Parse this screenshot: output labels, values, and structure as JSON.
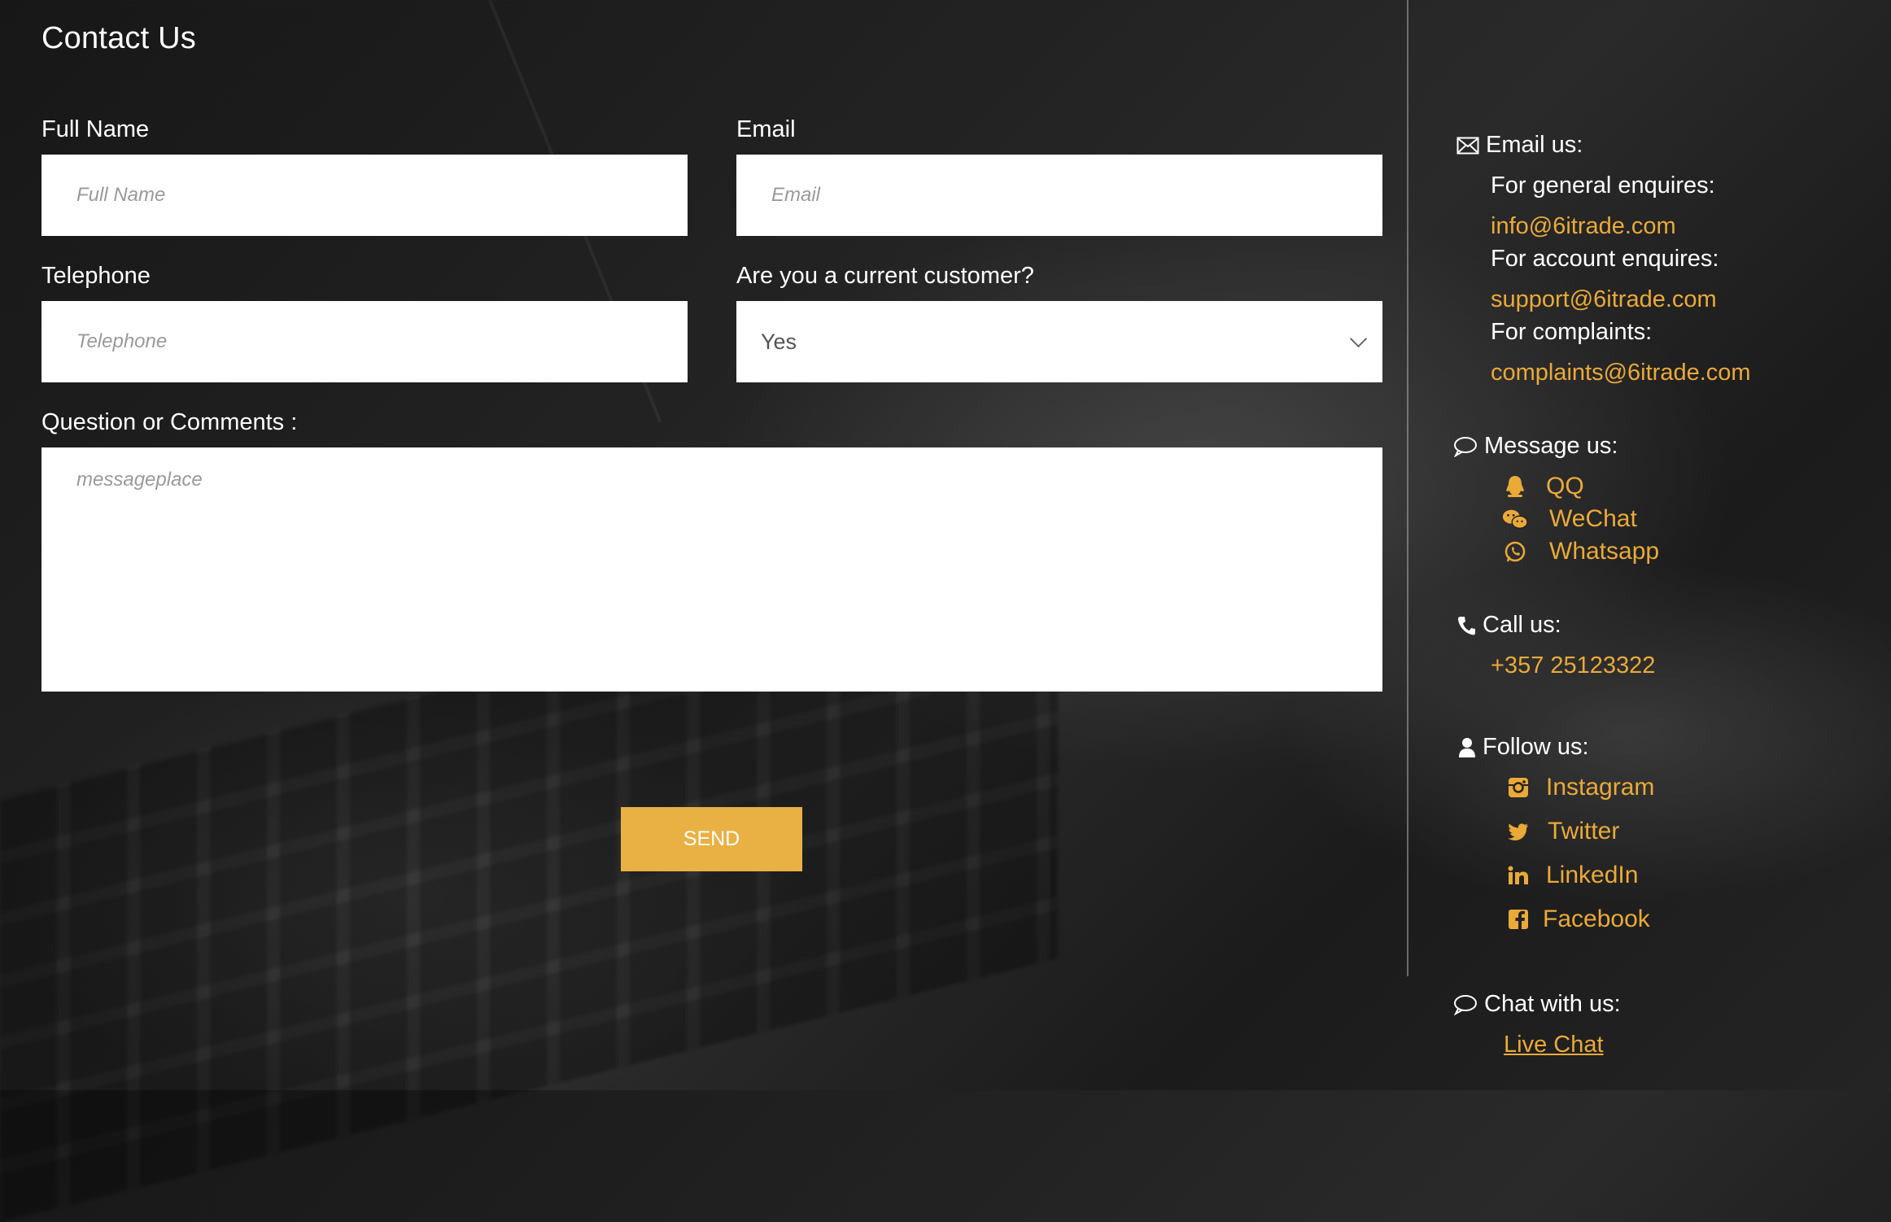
{
  "page_title": "Contact Us",
  "form": {
    "full_name": {
      "label": "Full Name",
      "placeholder": "Full Name",
      "value": ""
    },
    "email": {
      "label": "Email",
      "placeholder": "Email",
      "value": ""
    },
    "telephone": {
      "label": "Telephone",
      "placeholder": "Telephone",
      "value": ""
    },
    "customer": {
      "label": "Are you a current customer?",
      "selected": "Yes"
    },
    "comments": {
      "label": "Question or Comments :",
      "placeholder": "messageplace",
      "value": ""
    },
    "send_label": "SEND"
  },
  "sidebar": {
    "email": {
      "heading": "Email us:",
      "icon": "envelope-icon",
      "general_label": "For general enquires:",
      "general_email": "info@6itrade.com",
      "account_label": "For account enquires:",
      "account_email": "support@6itrade.com",
      "complaints_label": "For complaints:",
      "complaints_email": "complaints@6itrade.com"
    },
    "message": {
      "heading": "Message us:",
      "icon": "speech-bubble-icon",
      "items": [
        {
          "label": "QQ",
          "icon": "qq-icon"
        },
        {
          "label": "WeChat",
          "icon": "wechat-icon"
        },
        {
          "label": "Whatsapp",
          "icon": "whatsapp-icon"
        }
      ]
    },
    "call": {
      "heading": "Call us:",
      "icon": "phone-icon",
      "number": "+357 25123322"
    },
    "follow": {
      "heading": "Follow us:",
      "icon": "user-icon",
      "items": [
        {
          "label": "Instagram",
          "icon": "instagram-icon"
        },
        {
          "label": "Twitter",
          "icon": "twitter-icon"
        },
        {
          "label": "LinkedIn",
          "icon": "linkedin-icon"
        },
        {
          "label": "Facebook",
          "icon": "facebook-icon"
        }
      ]
    },
    "chat": {
      "heading": "Chat with us:",
      "icon": "speech-bubble-icon",
      "link": "Live Chat"
    }
  },
  "colors": {
    "accent": "#eaaa38",
    "button": "#e9b143",
    "text": "#ffffff"
  }
}
